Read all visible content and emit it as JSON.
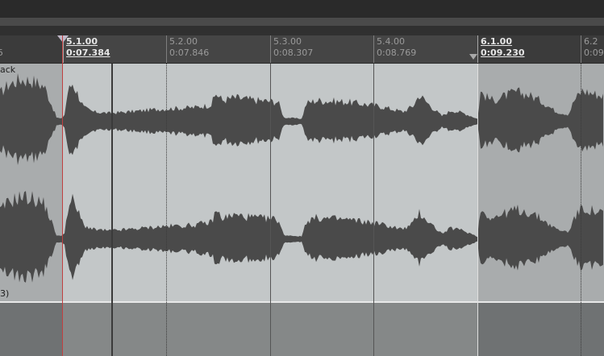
{
  "ruler": {
    "markers": [
      {
        "beat": "5.1.00",
        "time": "0:07.384",
        "major": true
      },
      {
        "beat": "5.2.00",
        "time": "0:07.846",
        "major": false
      },
      {
        "beat": "5.3.00",
        "time": "0:08.307",
        "major": false
      },
      {
        "beat": "5.4.00",
        "time": "0:08.769",
        "major": false
      },
      {
        "beat": "6.1.00",
        "time": "0:09.230",
        "major": true
      },
      {
        "beat": "6.2",
        "time": "0:09",
        "major": false
      }
    ],
    "left_cut_label": "5"
  },
  "track": {
    "item_name_fragment": "ack",
    "item_take_fragment": "3)"
  },
  "colors": {
    "waveform": "#4a4a4a",
    "waveform_dark": "#3a3a3a",
    "item_bg": "#c3c7c8",
    "playhead": "#c04040"
  }
}
